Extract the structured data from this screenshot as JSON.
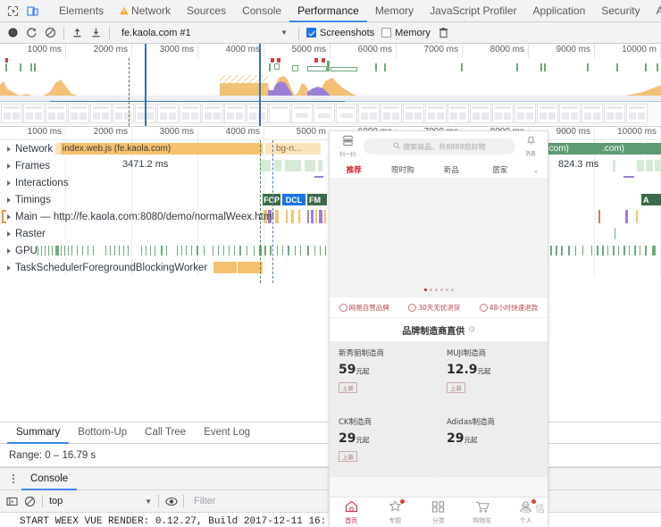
{
  "devtools": {
    "toolbar_icons": [
      "inspect-icon",
      "device-toolbar-icon"
    ],
    "tabs": [
      {
        "label": "Elements",
        "selected": false,
        "warning": false
      },
      {
        "label": "Network",
        "selected": false,
        "warning": true
      },
      {
        "label": "Sources",
        "selected": false,
        "warning": false
      },
      {
        "label": "Console",
        "selected": false,
        "warning": false
      },
      {
        "label": "Performance",
        "selected": true,
        "warning": false
      },
      {
        "label": "Memory",
        "selected": false,
        "warning": false
      },
      {
        "label": "JavaScript Profiler",
        "selected": false,
        "warning": false
      },
      {
        "label": "Application",
        "selected": false,
        "warning": false
      },
      {
        "label": "Security",
        "selected": false,
        "warning": false
      },
      {
        "label": "A",
        "selected": false,
        "warning": false
      }
    ],
    "controls": {
      "record_icon": "record-icon",
      "reload_icon": "reload-record-icon",
      "clear_icon": "clear-icon",
      "load_icon": "load-profile-icon",
      "save_icon": "save-profile-icon",
      "session_value": "fe.kaola.com #1",
      "screenshots_label": "Screenshots",
      "screenshots_checked": true,
      "memory_label": "Memory",
      "memory_checked": false,
      "trash_icon": "trash-icon"
    },
    "overview": {
      "ticks": [
        "1000 ms",
        "2000 ms",
        "3000 ms",
        "4000 ms",
        "5000 ms",
        "6000 ms",
        "7000 ms",
        "8000 ms",
        "9000 ms",
        "10000 m"
      ]
    },
    "timeline": {
      "ticks": [
        "1000 ms",
        "2000 ms",
        "3000 ms",
        "4000 ms",
        "5000 m",
        "6000 ms",
        "7000 ms",
        "8000 ms",
        "9000 ms",
        "10000 ms"
      ],
      "tracks": [
        {
          "name": "Network",
          "expanded": false
        },
        {
          "name": "Frames",
          "expanded": false
        },
        {
          "name": "Interactions",
          "expanded": false
        },
        {
          "name": "Timings",
          "expanded": false
        },
        {
          "name": "Main — http://fe.kaola.com:8080/demo/normalWeex.html",
          "expanded": false
        },
        {
          "name": "Raster",
          "expanded": false
        },
        {
          "name": "GPU",
          "expanded": false
        },
        {
          "name": "TaskSchedulerForegroundBlockingWorker",
          "expanded": false
        }
      ],
      "network_requests": [
        {
          "label": "index.web.js (fe.kaola.com)",
          "style": "orange"
        },
        {
          "label": "bg-n...",
          "style": "pale"
        },
        {
          "label": "will.com)",
          "style": "green"
        },
        {
          "label": ".com)",
          "style": "green"
        }
      ],
      "frame_labels": [
        "3471.2 ms",
        "824.3 ms"
      ],
      "timing_markers": [
        {
          "label": "FCP",
          "color": "#3d6b4a"
        },
        {
          "label": "DCL",
          "color": "#1a73e8"
        },
        {
          "label": "FM",
          "color": "#3d6b4a"
        }
      ]
    },
    "bottom_tabs": [
      {
        "label": "Summary",
        "selected": true
      },
      {
        "label": "Bottom-Up",
        "selected": false
      },
      {
        "label": "Call Tree",
        "selected": false
      },
      {
        "label": "Event Log",
        "selected": false
      }
    ],
    "range_text": "Range: 0 – 16.79 s",
    "console": {
      "menu_icon": "kebab-menu-icon",
      "tab_label": "Console",
      "execute_icon": "execution-context-icon",
      "clear_icon": "clear-console-icon",
      "context_value": "top",
      "eye_icon": "live-expression-icon",
      "filter_placeholder": "Filter",
      "log_line": "START WEEX VUE RENDER: 0.12.27, Build 2017-12-11 16:"
    }
  },
  "phone": {
    "scan_icon": "scan-icon",
    "scan_label": "扫一扫",
    "search_icon": "search-icon",
    "search_placeholder": "搜索商品，共8888款好物",
    "bell_icon": "bell-icon",
    "bell_label": "消息",
    "tabs": [
      {
        "label": "推荐",
        "selected": true
      },
      {
        "label": "限时购",
        "selected": false
      },
      {
        "label": "新品",
        "selected": false
      },
      {
        "label": "居家",
        "selected": false
      }
    ],
    "tab_more_icon": "chevron-down-icon",
    "promos": [
      "网易自营品牌",
      "30天无忧退货",
      "48小时快速退款"
    ],
    "section_title": "品牌制造商直供",
    "section_arrow_icon": "chevron-right-circle-icon",
    "cards": [
      {
        "title": "新秀丽制造商",
        "price": "59",
        "unit": "元起",
        "tag": "上新"
      },
      {
        "title": "MUJI制造商",
        "price": "12.9",
        "unit": "元起",
        "tag": "上新"
      },
      {
        "title": "CK制造商",
        "price": "29",
        "unit": "元起",
        "tag": "上新"
      },
      {
        "title": "Adidas制造商",
        "price": "29",
        "unit": "元起",
        "tag": ""
      }
    ],
    "nav": [
      {
        "icon": "home-icon",
        "label": "首页",
        "selected": true,
        "badge": false
      },
      {
        "icon": "topic-icon",
        "label": "专题",
        "selected": false,
        "badge": true
      },
      {
        "icon": "category-icon",
        "label": "分类",
        "selected": false,
        "badge": false
      },
      {
        "icon": "cart-icon",
        "label": "购物车",
        "selected": false,
        "badge": false
      },
      {
        "icon": "person-icon",
        "label": "个人",
        "selected": false,
        "badge": true
      }
    ],
    "watermark": "福 信"
  },
  "colors": {
    "accent": "#4285f4",
    "network_orange": "#f5c16e",
    "network_green": "#5d9b72",
    "frame_green": "#d6ead8",
    "gpu_green": "#6ea97e",
    "brand_red": "#c8202e"
  }
}
